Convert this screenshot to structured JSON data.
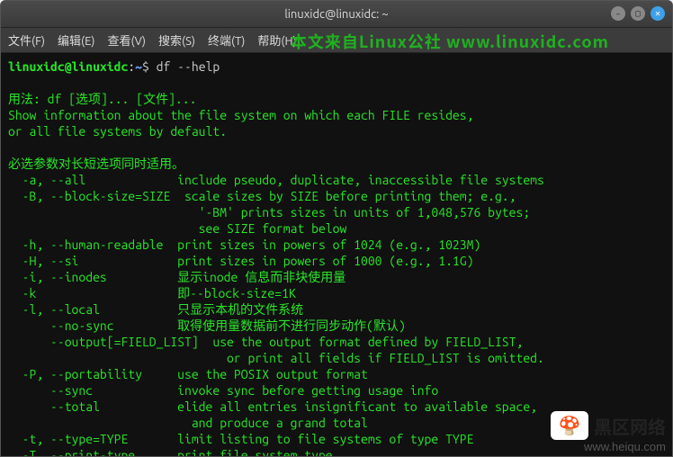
{
  "window": {
    "title": "linuxidc@linuxidc: ~"
  },
  "menubar": {
    "items": [
      "文件(F)",
      "编辑(E)",
      "查看(V)",
      "搜索(S)",
      "终端(T)",
      "帮助(H)"
    ]
  },
  "watermark_top": "本文来自Linux公社 www.linuxidc.com",
  "prompt": {
    "userhost": "linuxidc@linuxidc",
    "sep": ":",
    "path": "~",
    "dollar": "$",
    "command": " df --help"
  },
  "output_lines": [
    "用法: df [选项]... [文件]...",
    "Show information about the file system on which each FILE resides,",
    "or all file systems by default.",
    "",
    "必选参数对长短选项同时适用。",
    "  -a, --all             include pseudo, duplicate, inaccessible file systems",
    "  -B, --block-size=SIZE  scale sizes by SIZE before printing them; e.g.,",
    "                           '-BM' prints sizes in units of 1,048,576 bytes;",
    "                           see SIZE format below",
    "  -h, --human-readable  print sizes in powers of 1024 (e.g., 1023M)",
    "  -H, --si              print sizes in powers of 1000 (e.g., 1.1G)",
    "  -i, --inodes          显示inode 信息而非块使用量",
    "  -k                    即--block-size=1K",
    "  -l, --local           只显示本机的文件系统",
    "      --no-sync         取得使用量数据前不进行同步动作(默认)",
    "      --output[=FIELD_LIST]  use the output format defined by FIELD_LIST,",
    "                               or print all fields if FIELD_LIST is omitted.",
    "  -P, --portability     use the POSIX output format",
    "      --sync            invoke sync before getting usage info",
    "      --total           elide all entries insignificant to available space,",
    "                          and produce a grand total",
    "  -t, --type=TYPE       limit listing to file systems of type TYPE",
    "  -T, --print-type      print file system type"
  ],
  "watermark_br": {
    "label": "黑区网络",
    "url": "www.heiqu.com"
  }
}
